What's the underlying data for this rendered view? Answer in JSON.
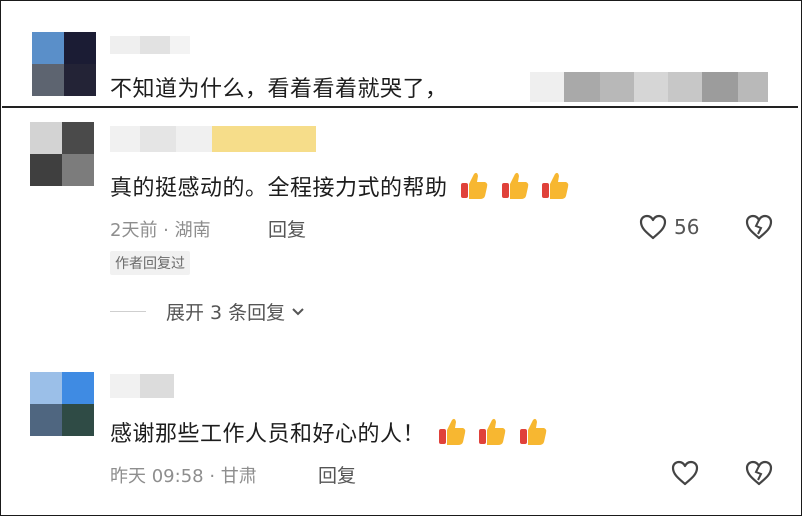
{
  "comments": [
    {
      "text": "不知道为什么，看着看着就哭了，"
    },
    {
      "text": "真的挺感动的。全程接力式的帮助",
      "time_location": "2天前 · 湖南",
      "reply_label": "回复",
      "likes": "56",
      "author_badge": "作者回复过",
      "expand_label": "展开 3 条回复"
    },
    {
      "text": "感谢那些工作人员和好心的人！",
      "time_location": "昨天 09:58 · 甘肃",
      "reply_label": "回复"
    }
  ],
  "icons": {
    "thumb": "thumbs-up-emoji",
    "like": "heart-icon",
    "dislike": "broken-heart-icon",
    "expand": "chevron-down-icon"
  },
  "colors": {
    "thumb_yellow": "#f7b731",
    "thumb_red": "#e0413a",
    "meta_gray": "#8e8e8e"
  }
}
